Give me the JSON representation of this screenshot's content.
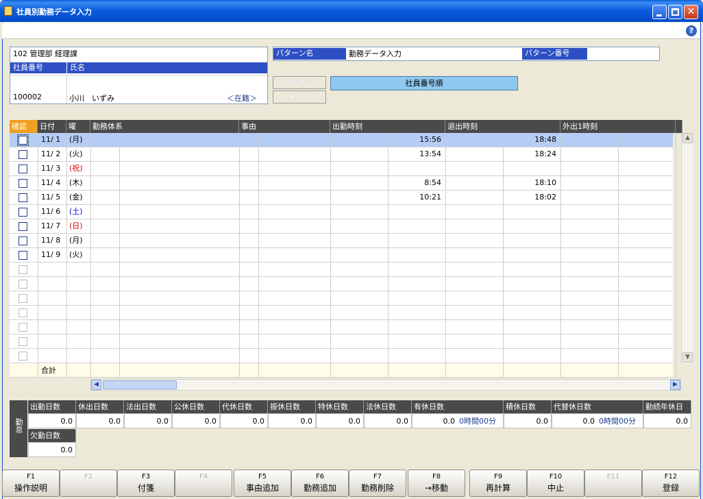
{
  "window": {
    "title": "社員別勤務データ入力"
  },
  "employee": {
    "dept": "102 管理部 経理課",
    "id_header": "社員番号",
    "name_header": "氏名",
    "id": "100002",
    "name": "小川　いずみ",
    "status": "＜在籍＞"
  },
  "pattern": {
    "name_label": "パターン名",
    "name_value": "勤務データ入力",
    "number_label": "パターン番号",
    "number_value": ""
  },
  "display": {
    "screen_btn": "画面表示",
    "unstamp_btn": "未打刻",
    "sort_label": "社員番号順"
  },
  "grid": {
    "headers": {
      "confirm": "確認",
      "date": "日付",
      "dow": "曜",
      "pattern": "勤務体系",
      "reason": "事由",
      "clock_in": "出勤時刻",
      "clock_out": "退出時刻",
      "outing": "外出1時刻"
    },
    "rows": [
      {
        "date": "11/ 1",
        "dow": "(月)",
        "type": "",
        "in": "15:56",
        "out": "18:48"
      },
      {
        "date": "11/ 2",
        "dow": "(火)",
        "type": "",
        "in": "13:54",
        "out": "18:24"
      },
      {
        "date": "11/ 3",
        "dow": "(祝)",
        "type": "sun",
        "in": "",
        "out": ""
      },
      {
        "date": "11/ 4",
        "dow": "(木)",
        "type": "",
        "in": "8:54",
        "out": "18:10"
      },
      {
        "date": "11/ 5",
        "dow": "(金)",
        "type": "",
        "in": "10:21",
        "out": "18:02"
      },
      {
        "date": "11/ 6",
        "dow": "(土)",
        "type": "sat",
        "in": "",
        "out": ""
      },
      {
        "date": "11/ 7",
        "dow": "(日)",
        "type": "sun",
        "in": "",
        "out": ""
      },
      {
        "date": "11/ 8",
        "dow": "(月)",
        "type": "",
        "in": "",
        "out": ""
      },
      {
        "date": "11/ 9",
        "dow": "(火)",
        "type": "",
        "in": "",
        "out": ""
      }
    ],
    "total_label": "合計"
  },
  "summary": {
    "section_label": "勤怠",
    "items": [
      {
        "label": "出勤日数",
        "value": "0.0"
      },
      {
        "label": "休出日数",
        "value": "0.0"
      },
      {
        "label": "法出日数",
        "value": "0.0"
      },
      {
        "label": "公休日数",
        "value": "0.0"
      },
      {
        "label": "代休日数",
        "value": "0.0"
      },
      {
        "label": "振休日数",
        "value": "0.0"
      },
      {
        "label": "特休日数",
        "value": "0.0"
      },
      {
        "label": "法休日数",
        "value": "0.0"
      },
      {
        "label": "有休日数",
        "value": "0.0",
        "extra": "0時間00分"
      },
      {
        "label": "積休日数",
        "value": "0.0"
      },
      {
        "label": "代替休日数",
        "value": "0.0",
        "extra": "0時間00分"
      },
      {
        "label": "勤続年休日",
        "value": "0.0"
      }
    ],
    "absence": {
      "label": "欠勤日数",
      "value": "0.0"
    }
  },
  "fkeys": [
    {
      "key": "F1",
      "label": "操作説明",
      "enabled": true
    },
    {
      "key": "F2",
      "label": "",
      "enabled": false
    },
    {
      "key": "F3",
      "label": "付箋",
      "enabled": true
    },
    {
      "key": "F4",
      "label": "",
      "enabled": false
    },
    {
      "key": "F5",
      "label": "事由追加",
      "enabled": true
    },
    {
      "key": "F6",
      "label": "勤務追加",
      "enabled": true
    },
    {
      "key": "F7",
      "label": "勤務削除",
      "enabled": true
    },
    {
      "key": "F8",
      "label": "→移動",
      "enabled": true
    },
    {
      "key": "F9",
      "label": "再計算",
      "enabled": true
    },
    {
      "key": "F10",
      "label": "中止",
      "enabled": true
    },
    {
      "key": "F11",
      "label": "",
      "enabled": false
    },
    {
      "key": "F12",
      "label": "登録",
      "enabled": true
    }
  ],
  "colors": {
    "titlebar": "#0b5ee0",
    "header_blue": "#2e50c4",
    "grid_header": "#4a4a4a",
    "confirm_header": "#f0a020",
    "selected_row": "#b5cdf5",
    "sort_label_bg": "#8ec8f0"
  }
}
